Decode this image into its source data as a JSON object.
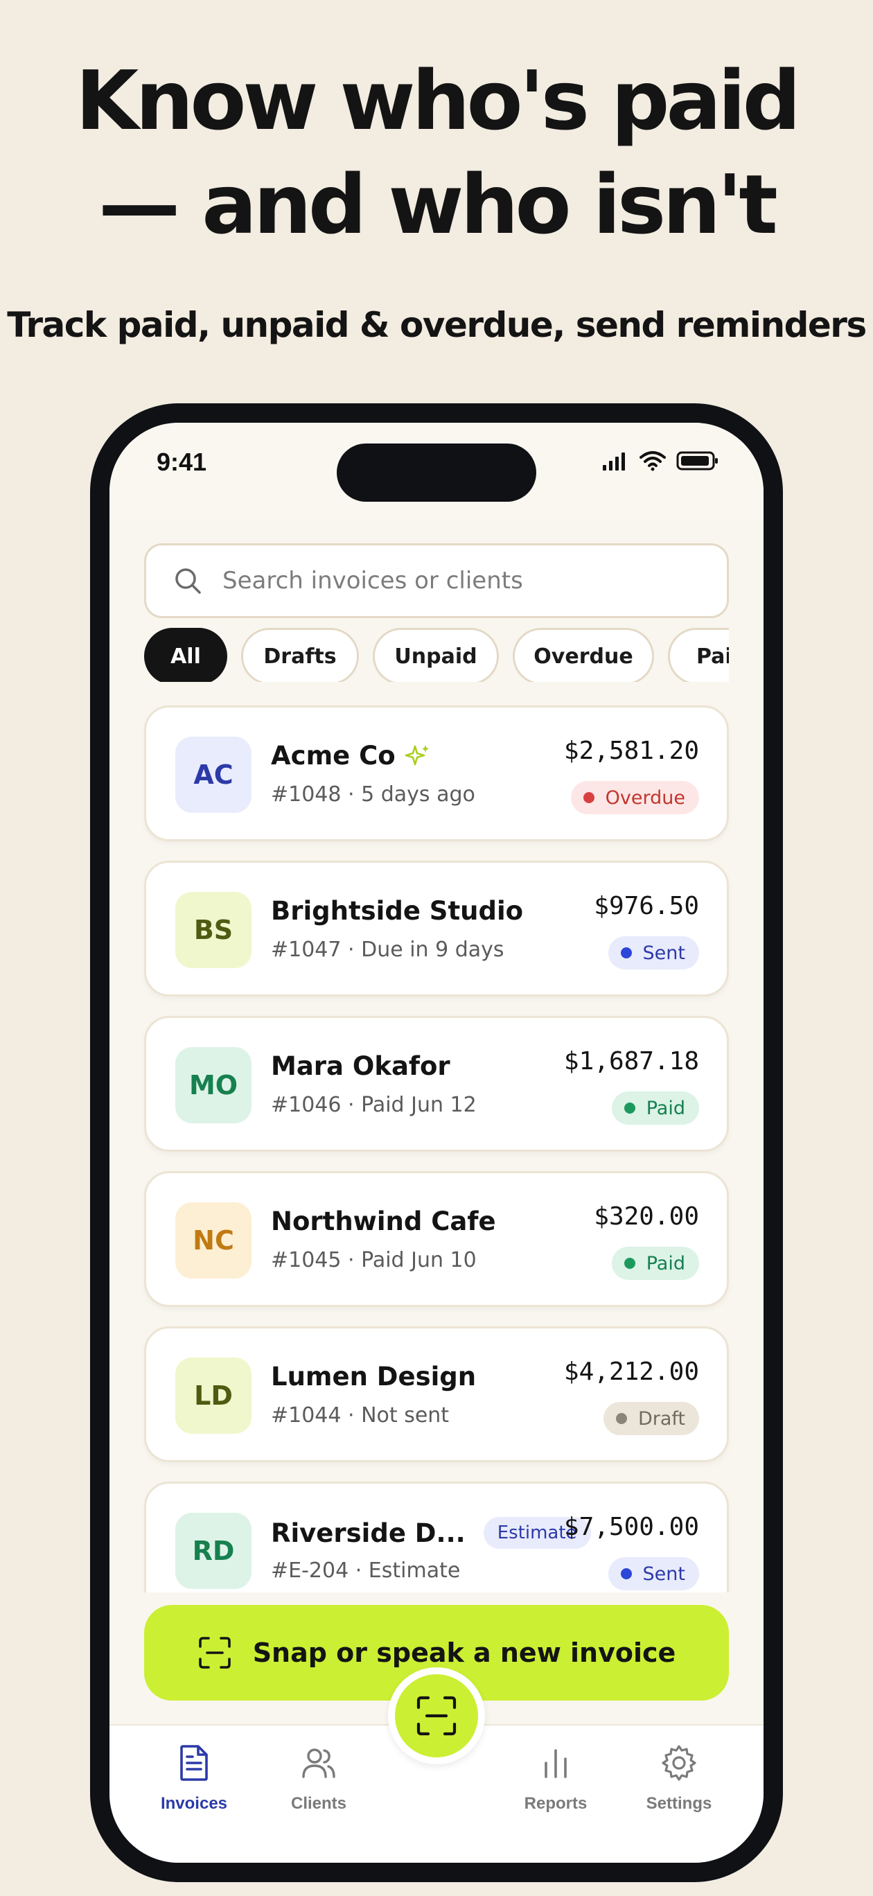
{
  "headline": {
    "line1": "Know who's paid",
    "line2": "— and who isn't"
  },
  "subhead": "Track paid, unpaid & overdue, send reminders",
  "status_bar": {
    "time": "9:41"
  },
  "search": {
    "placeholder": "Search invoices or clients"
  },
  "filters": [
    "All",
    "Drafts",
    "Unpaid",
    "Overdue",
    "Paid"
  ],
  "invoices": [
    {
      "initials": "AC",
      "name": "Acme Co",
      "meta": "#1048 · 5 days ago",
      "amount": "$2,581.20",
      "status": "Overdue",
      "sparkle": true
    },
    {
      "initials": "BS",
      "name": "Brightside Studio",
      "meta": "#1047 · Due in 9 days",
      "amount": "$976.50",
      "status": "Sent"
    },
    {
      "initials": "MO",
      "name": "Mara Okafor",
      "meta": "#1046 · Paid Jun 12",
      "amount": "$1,687.18",
      "status": "Paid"
    },
    {
      "initials": "NC",
      "name": "Northwind Cafe",
      "meta": "#1045 · Paid Jun 10",
      "amount": "$320.00",
      "status": "Paid"
    },
    {
      "initials": "LD",
      "name": "Lumen Design",
      "meta": "#1044 · Not sent",
      "amount": "$4,212.00",
      "status": "Draft"
    },
    {
      "initials": "RD",
      "name": "Riverside D...",
      "meta": "#E-204 · Estimate",
      "amount": "$7,500.00",
      "status": "Sent",
      "tag": "Estimate"
    }
  ],
  "cta": {
    "label": "Snap or speak a new invoice"
  },
  "tabs": [
    {
      "label": "Invoices",
      "icon": "document-icon",
      "active": true
    },
    {
      "label": "Clients",
      "icon": "users-icon"
    },
    {
      "label": "Reports",
      "icon": "bar-chart-icon"
    },
    {
      "label": "Settings",
      "icon": "gear-icon"
    }
  ],
  "colors": {
    "background": "#f2ece1",
    "accent_lime": "#cbef33",
    "active_tab": "#2c3aa8",
    "overdue": "#d84040",
    "sent": "#2c46d8",
    "paid": "#1c9a5e",
    "draft": "#8a8578"
  }
}
